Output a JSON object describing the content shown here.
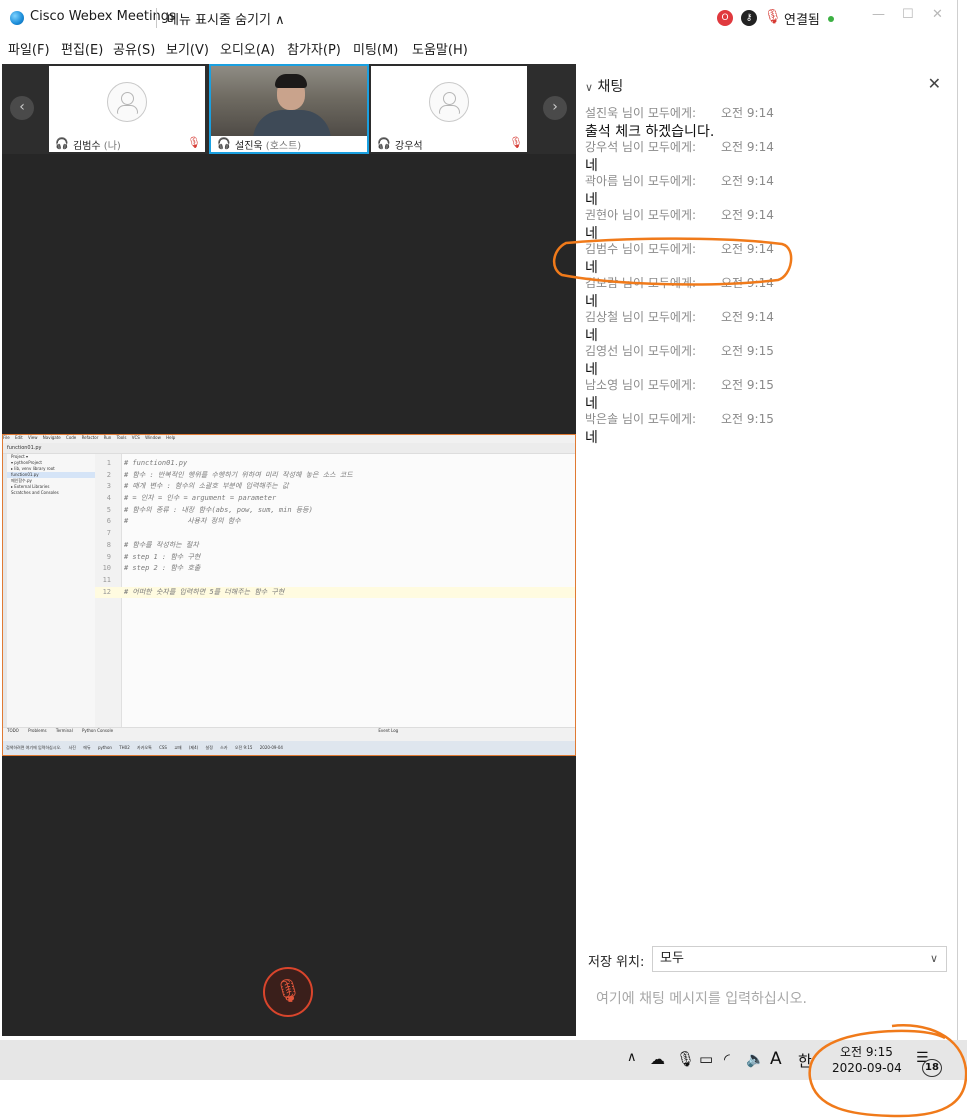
{
  "window": {
    "app_title": "Cisco Webex Meetings",
    "hide_menu_label": "메뉴 표시줄 숨기기 ∧",
    "connection_status": "연결됨",
    "controls": [
      "—",
      "☐",
      "✕"
    ]
  },
  "menu": [
    "파일(F)",
    "편집(E)",
    "공유(S)",
    "보기(V)",
    "오디오(A)",
    "참가자(P)",
    "미팅(M)",
    "도움말(H)"
  ],
  "participants": [
    {
      "name": "김범수",
      "tag": "(나)",
      "muted": true,
      "active": false
    },
    {
      "name": "설진욱",
      "tag": "(호스트)",
      "muted": false,
      "active": true
    },
    {
      "name": "강우석",
      "tag": "",
      "muted": true,
      "active": false
    }
  ],
  "shared_screen": {
    "ide_menu": [
      "File",
      "Edit",
      "View",
      "Navigate",
      "Code",
      "Refactor",
      "Run",
      "Tools",
      "VCS",
      "Window",
      "Help"
    ],
    "ide_tab": "function01.py",
    "project_tree": [
      "Project ▾",
      "▾ pythonProject",
      "  ▸ lib, venv library root",
      "  function01.py",
      "  메인함수.py",
      "▸ External Libraries",
      "  Scratches and Consoles"
    ],
    "code_lines": [
      {
        "n": "1",
        "t": "# function01.py"
      },
      {
        "n": "2",
        "t": "# 함수 : 반복적인 행위를 수행하기 위하여 미리 작성해 놓은 소스 코드"
      },
      {
        "n": "3",
        "t": "# 매개 변수 : 함수의 소괄호 부분에 입력해주는 값"
      },
      {
        "n": "4",
        "t": "# = 인자 = 인수 = argument = parameter"
      },
      {
        "n": "5",
        "t": "# 함수의 종류 : 내장 함수(abs, pow, sum, min 등등)"
      },
      {
        "n": "6",
        "t": "#              사용자 정의 함수"
      },
      {
        "n": "7",
        "t": ""
      },
      {
        "n": "8",
        "t": "# 함수를 작성하는 절차"
      },
      {
        "n": "9",
        "t": "# step 1 : 함수 구현"
      },
      {
        "n": "10",
        "t": "# step 2 : 함수 호출"
      },
      {
        "n": "11",
        "t": ""
      },
      {
        "n": "12",
        "t": "# 어떠한 숫자를 입력하면 5를 더해주는 함수 구현"
      }
    ],
    "status_items": [
      "TODO",
      "Problems",
      "Terminal",
      "Python Console",
      "Event Log"
    ],
    "status_right": [
      "12:29",
      "CRLF",
      "UTF-8",
      "4 spaces",
      "Python 3.7"
    ],
    "taskbar_items": [
      "검색하려면 여기에 입력하십시오.",
      "사진",
      "에듀",
      "python",
      "TH02",
      "카카오톡",
      "CSS",
      "교재",
      "(제4)",
      "설정",
      "스카"
    ],
    "taskbar_clock": [
      "오전 9:15",
      "2020-09-04"
    ]
  },
  "chat": {
    "title": "채팅",
    "messages": [
      {
        "sender": "설진욱 님이 모두에게:",
        "time": "오전 9:14",
        "text": "출석 체크 하겠습니다."
      },
      {
        "sender": "강우석 님이 모두에게:",
        "time": "오전 9:14",
        "text": "네"
      },
      {
        "sender": "곽아름 님이 모두에게:",
        "time": "오전 9:14",
        "text": "네"
      },
      {
        "sender": "권현아 님이 모두에게:",
        "time": "오전 9:14",
        "text": "네"
      },
      {
        "sender": "김범수 님이 모두에게:",
        "time": "오전 9:14",
        "text": "네"
      },
      {
        "sender": "김보람 님이 모두에게:",
        "time": "오전 9:14",
        "text": "네"
      },
      {
        "sender": "김상철 님이 모두에게:",
        "time": "오전 9:14",
        "text": "네"
      },
      {
        "sender": "김영선 님이 모두에게:",
        "time": "오전 9:15",
        "text": "네"
      },
      {
        "sender": "남소영 님이 모두에게:",
        "time": "오전 9:15",
        "text": "네"
      },
      {
        "sender": "박은솔 님이 모두에게:",
        "time": "오전 9:15",
        "text": "네"
      }
    ],
    "save_label": "저장 위치:",
    "save_value": "모두",
    "input_placeholder": "여기에 채팅 메시지를 입력하십시오."
  },
  "taskbar": {
    "ime": "A",
    "lang": "한",
    "time": "오전 9:15",
    "date": "2020-09-04",
    "notification_count": "18"
  },
  "colors": {
    "accent_active_tile": "#1aa0e0",
    "muted_red": "#d63a33",
    "annotation_orange": "#f07a1a",
    "connected_green": "#3cb043"
  }
}
